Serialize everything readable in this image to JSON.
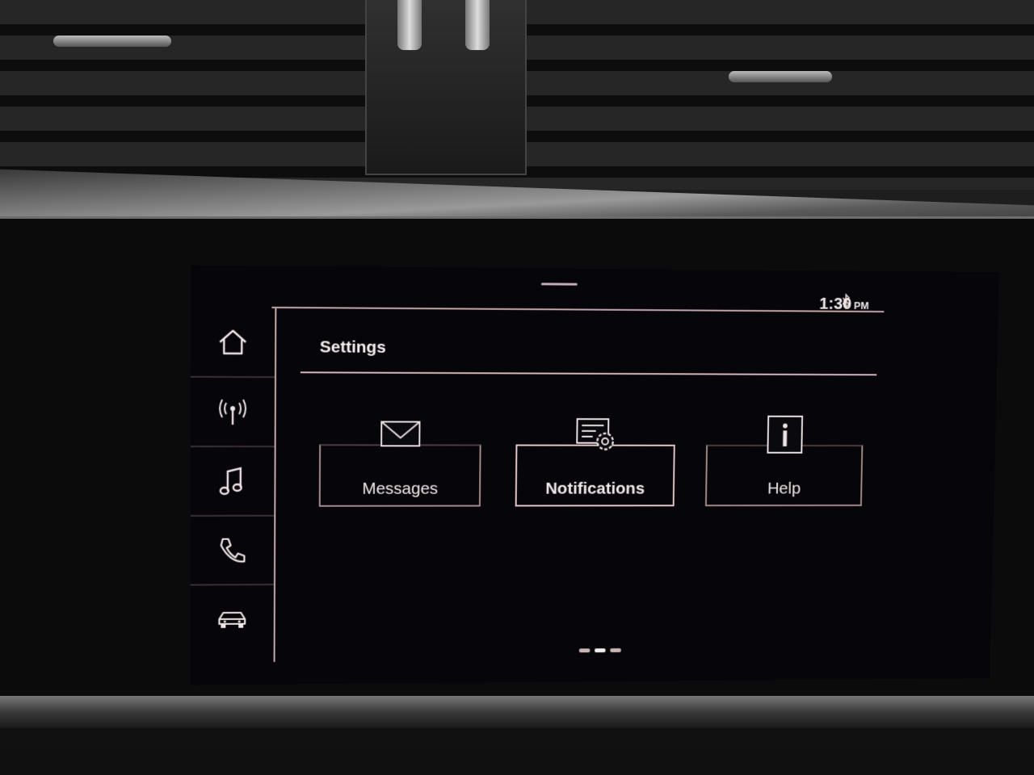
{
  "status_bar": {
    "bluetooth_icon": "bluetooth-icon",
    "time": "1:30",
    "ampm": "PM"
  },
  "sidebar": {
    "items": [
      {
        "name": "home",
        "icon": "home-icon"
      },
      {
        "name": "radio",
        "icon": "radio-antenna-icon"
      },
      {
        "name": "media",
        "icon": "music-note-icon"
      },
      {
        "name": "phone",
        "icon": "phone-icon"
      },
      {
        "name": "vehicle",
        "icon": "car-icon"
      }
    ]
  },
  "main": {
    "title": "Settings",
    "tiles": [
      {
        "label": "Messages",
        "icon": "envelope-icon"
      },
      {
        "label": "Notifications",
        "icon": "notification-settings-icon"
      },
      {
        "label": "Help",
        "icon": "info-icon"
      }
    ],
    "pager": {
      "pages": 3,
      "current": 2
    }
  },
  "colors": {
    "accent_line": "#d7b7b7",
    "text": "#f5eeee",
    "screen_bg": "#06060a"
  }
}
